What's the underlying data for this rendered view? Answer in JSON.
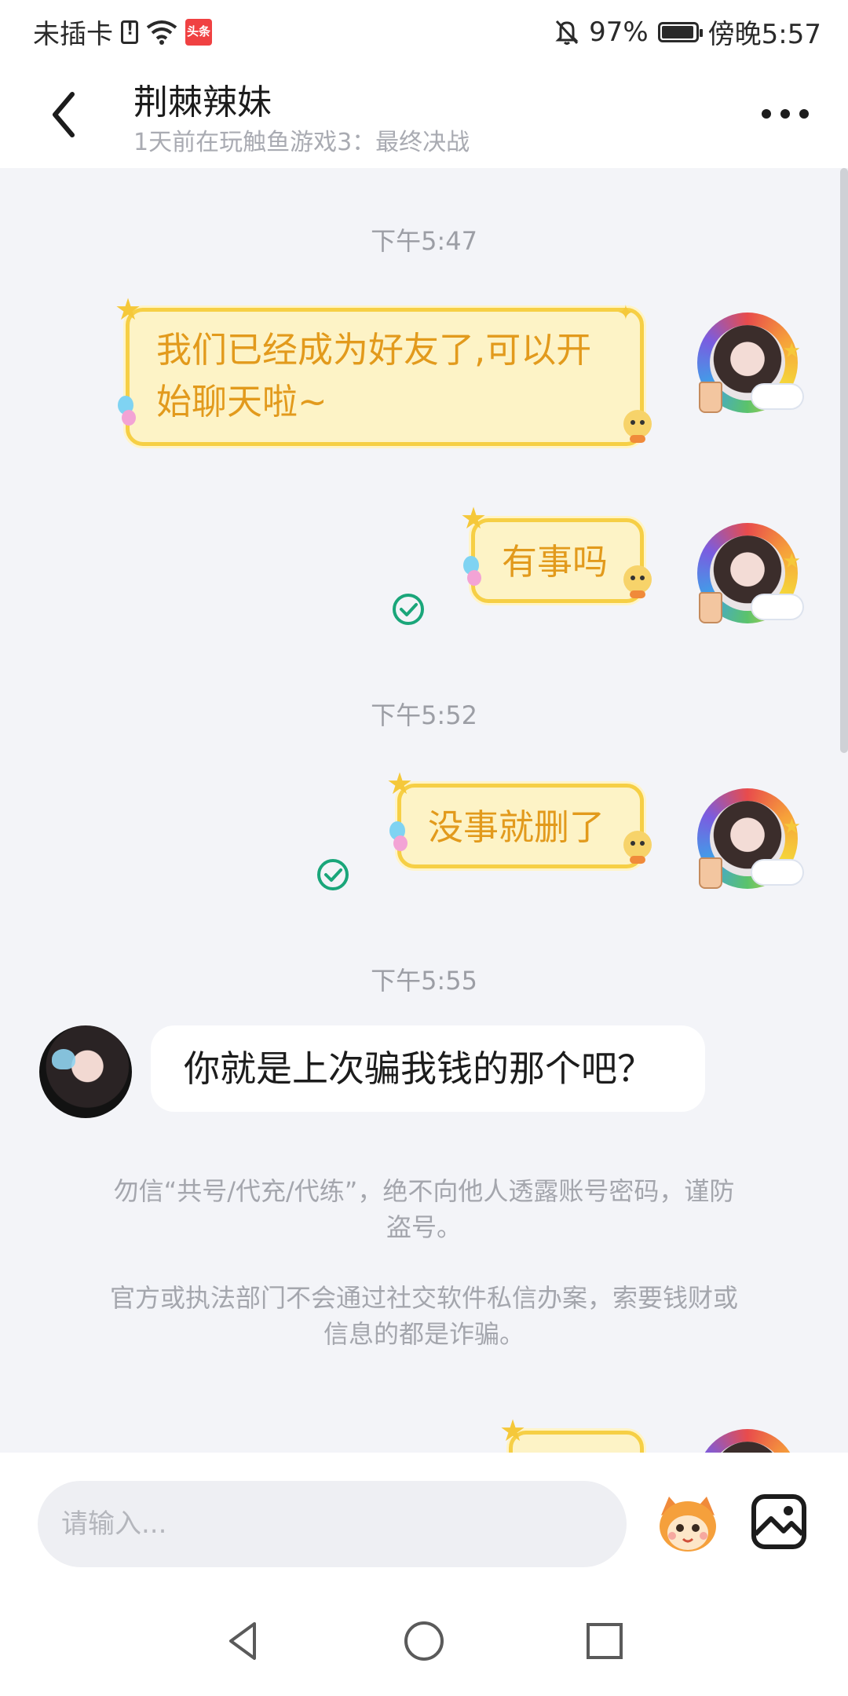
{
  "status_bar": {
    "carrier": "未插卡",
    "app_badge": "头条",
    "battery_percent": "97%",
    "battery_level": 0.97,
    "time": "傍晚5:57"
  },
  "header": {
    "title": "荆棘辣妹",
    "subtitle": "1天前在玩触鱼游戏3：最终决战"
  },
  "chat": {
    "timestamps": [
      "下午5:47",
      "下午5:52",
      "下午5:55"
    ],
    "messages": [
      {
        "direction": "outgoing",
        "text_line1": "我们已经成为好友了,可以开",
        "text_line2": "始聊天啦~"
      },
      {
        "direction": "outgoing",
        "text": "有事吗",
        "status": "read"
      },
      {
        "direction": "outgoing",
        "text": "没事就删了",
        "status": "read"
      },
      {
        "direction": "incoming",
        "text": "你就是上次骗我钱的那个吧？"
      }
    ],
    "notices": [
      {
        "line1": "勿信“共号/代充/代练”，绝不向他人透露账号密码，谨防",
        "line2": "盗号。"
      },
      {
        "line1": "官方或执法部门不会通过社交软件私信办案，索要钱财或",
        "line2": "信息的都是诈骗。"
      }
    ]
  },
  "input": {
    "placeholder": "请输入..."
  },
  "colors": {
    "bubble_fill": "#fdf3c6",
    "bubble_border": "#f6cf45",
    "bubble_text": "#e29a1c",
    "read_check": "#1aa67a"
  },
  "icons": [
    "back-arrow-icon",
    "more-icon",
    "read-check-icon",
    "emoji-mascot-icon",
    "image-icon",
    "nav-back-icon",
    "nav-home-icon",
    "nav-recent-icon"
  ]
}
